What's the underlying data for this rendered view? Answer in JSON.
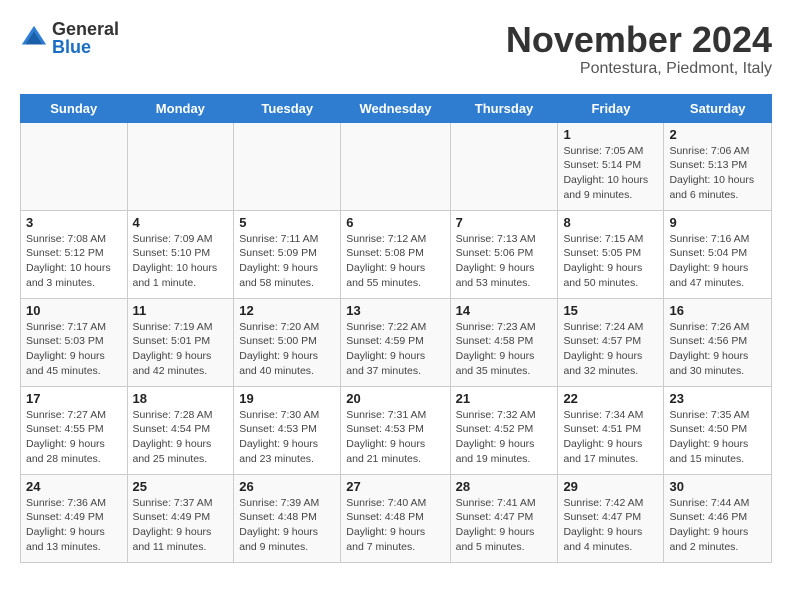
{
  "header": {
    "logo_general": "General",
    "logo_blue": "Blue",
    "month_title": "November 2024",
    "subtitle": "Pontestura, Piedmont, Italy"
  },
  "days_of_week": [
    "Sunday",
    "Monday",
    "Tuesday",
    "Wednesday",
    "Thursday",
    "Friday",
    "Saturday"
  ],
  "weeks": [
    [
      {
        "num": "",
        "info": ""
      },
      {
        "num": "",
        "info": ""
      },
      {
        "num": "",
        "info": ""
      },
      {
        "num": "",
        "info": ""
      },
      {
        "num": "",
        "info": ""
      },
      {
        "num": "1",
        "info": "Sunrise: 7:05 AM\nSunset: 5:14 PM\nDaylight: 10 hours and 9 minutes."
      },
      {
        "num": "2",
        "info": "Sunrise: 7:06 AM\nSunset: 5:13 PM\nDaylight: 10 hours and 6 minutes."
      }
    ],
    [
      {
        "num": "3",
        "info": "Sunrise: 7:08 AM\nSunset: 5:12 PM\nDaylight: 10 hours and 3 minutes."
      },
      {
        "num": "4",
        "info": "Sunrise: 7:09 AM\nSunset: 5:10 PM\nDaylight: 10 hours and 1 minute."
      },
      {
        "num": "5",
        "info": "Sunrise: 7:11 AM\nSunset: 5:09 PM\nDaylight: 9 hours and 58 minutes."
      },
      {
        "num": "6",
        "info": "Sunrise: 7:12 AM\nSunset: 5:08 PM\nDaylight: 9 hours and 55 minutes."
      },
      {
        "num": "7",
        "info": "Sunrise: 7:13 AM\nSunset: 5:06 PM\nDaylight: 9 hours and 53 minutes."
      },
      {
        "num": "8",
        "info": "Sunrise: 7:15 AM\nSunset: 5:05 PM\nDaylight: 9 hours and 50 minutes."
      },
      {
        "num": "9",
        "info": "Sunrise: 7:16 AM\nSunset: 5:04 PM\nDaylight: 9 hours and 47 minutes."
      }
    ],
    [
      {
        "num": "10",
        "info": "Sunrise: 7:17 AM\nSunset: 5:03 PM\nDaylight: 9 hours and 45 minutes."
      },
      {
        "num": "11",
        "info": "Sunrise: 7:19 AM\nSunset: 5:01 PM\nDaylight: 9 hours and 42 minutes."
      },
      {
        "num": "12",
        "info": "Sunrise: 7:20 AM\nSunset: 5:00 PM\nDaylight: 9 hours and 40 minutes."
      },
      {
        "num": "13",
        "info": "Sunrise: 7:22 AM\nSunset: 4:59 PM\nDaylight: 9 hours and 37 minutes."
      },
      {
        "num": "14",
        "info": "Sunrise: 7:23 AM\nSunset: 4:58 PM\nDaylight: 9 hours and 35 minutes."
      },
      {
        "num": "15",
        "info": "Sunrise: 7:24 AM\nSunset: 4:57 PM\nDaylight: 9 hours and 32 minutes."
      },
      {
        "num": "16",
        "info": "Sunrise: 7:26 AM\nSunset: 4:56 PM\nDaylight: 9 hours and 30 minutes."
      }
    ],
    [
      {
        "num": "17",
        "info": "Sunrise: 7:27 AM\nSunset: 4:55 PM\nDaylight: 9 hours and 28 minutes."
      },
      {
        "num": "18",
        "info": "Sunrise: 7:28 AM\nSunset: 4:54 PM\nDaylight: 9 hours and 25 minutes."
      },
      {
        "num": "19",
        "info": "Sunrise: 7:30 AM\nSunset: 4:53 PM\nDaylight: 9 hours and 23 minutes."
      },
      {
        "num": "20",
        "info": "Sunrise: 7:31 AM\nSunset: 4:53 PM\nDaylight: 9 hours and 21 minutes."
      },
      {
        "num": "21",
        "info": "Sunrise: 7:32 AM\nSunset: 4:52 PM\nDaylight: 9 hours and 19 minutes."
      },
      {
        "num": "22",
        "info": "Sunrise: 7:34 AM\nSunset: 4:51 PM\nDaylight: 9 hours and 17 minutes."
      },
      {
        "num": "23",
        "info": "Sunrise: 7:35 AM\nSunset: 4:50 PM\nDaylight: 9 hours and 15 minutes."
      }
    ],
    [
      {
        "num": "24",
        "info": "Sunrise: 7:36 AM\nSunset: 4:49 PM\nDaylight: 9 hours and 13 minutes."
      },
      {
        "num": "25",
        "info": "Sunrise: 7:37 AM\nSunset: 4:49 PM\nDaylight: 9 hours and 11 minutes."
      },
      {
        "num": "26",
        "info": "Sunrise: 7:39 AM\nSunset: 4:48 PM\nDaylight: 9 hours and 9 minutes."
      },
      {
        "num": "27",
        "info": "Sunrise: 7:40 AM\nSunset: 4:48 PM\nDaylight: 9 hours and 7 minutes."
      },
      {
        "num": "28",
        "info": "Sunrise: 7:41 AM\nSunset: 4:47 PM\nDaylight: 9 hours and 5 minutes."
      },
      {
        "num": "29",
        "info": "Sunrise: 7:42 AM\nSunset: 4:47 PM\nDaylight: 9 hours and 4 minutes."
      },
      {
        "num": "30",
        "info": "Sunrise: 7:44 AM\nSunset: 4:46 PM\nDaylight: 9 hours and 2 minutes."
      }
    ]
  ]
}
